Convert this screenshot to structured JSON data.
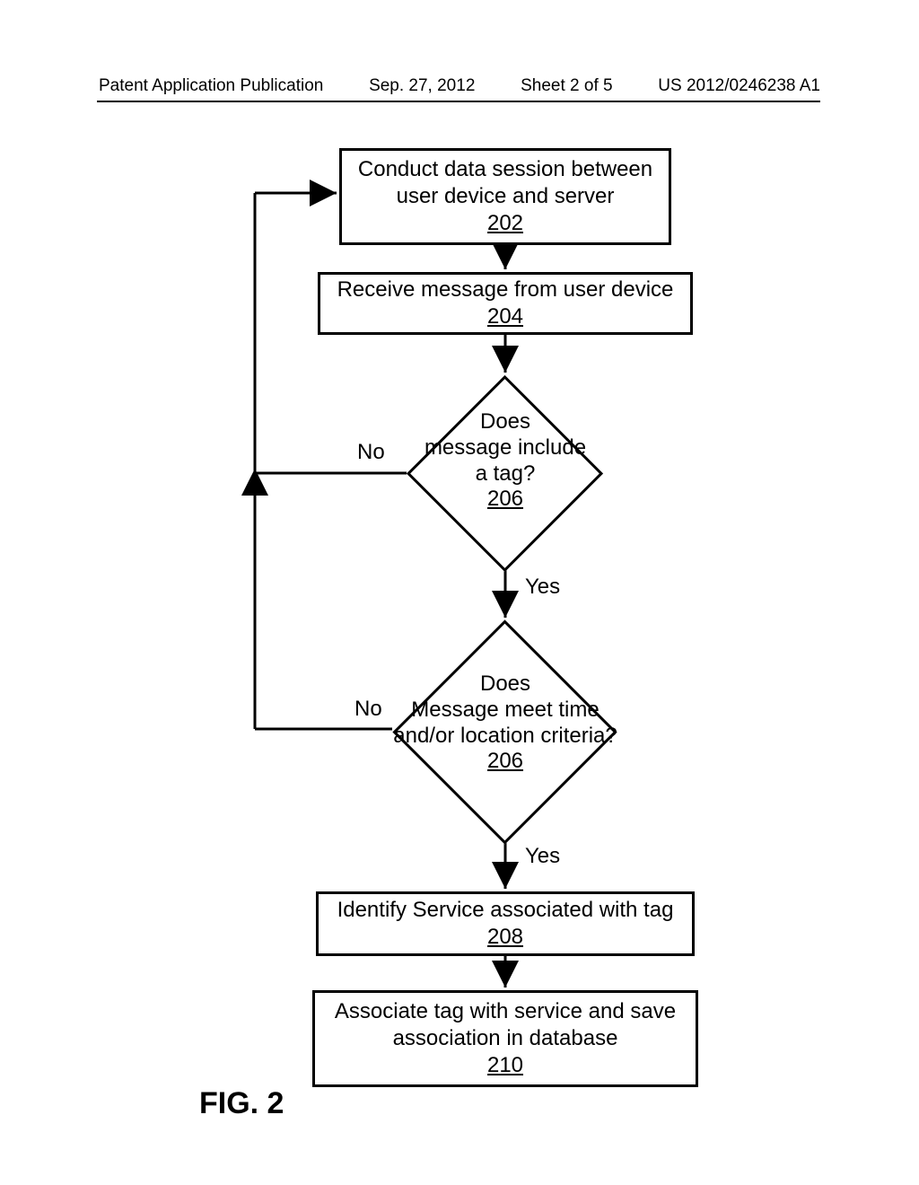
{
  "header": {
    "publication_label": "Patent Application Publication",
    "date": "Sep. 27, 2012",
    "sheet": "Sheet 2 of 5",
    "pub_number": "US 2012/0246238 A1"
  },
  "chart_data": {
    "type": "flowchart",
    "title": "FIG. 2",
    "nodes": [
      {
        "id": "202",
        "type": "process",
        "text": "Conduct data session between user device and server",
        "ref": "202"
      },
      {
        "id": "204",
        "type": "process",
        "text": "Receive message from user device",
        "ref": "204"
      },
      {
        "id": "206a",
        "type": "decision",
        "text": "Does message include a tag?",
        "ref": "206"
      },
      {
        "id": "206b",
        "type": "decision",
        "text": "Does Message meet time and/or location criteria?",
        "ref": "206"
      },
      {
        "id": "208",
        "type": "process",
        "text": "Identify Service associated with tag",
        "ref": "208"
      },
      {
        "id": "210",
        "type": "process",
        "text": "Associate tag with service and save association in database",
        "ref": "210"
      }
    ],
    "edges": [
      {
        "from": "202",
        "to": "204",
        "label": ""
      },
      {
        "from": "204",
        "to": "206a",
        "label": ""
      },
      {
        "from": "206a",
        "to": "206b",
        "label": "Yes"
      },
      {
        "from": "206b",
        "to": "208",
        "label": "Yes"
      },
      {
        "from": "208",
        "to": "210",
        "label": ""
      },
      {
        "from": "206a",
        "to": "202",
        "label": "No"
      },
      {
        "from": "206b",
        "to": "202",
        "label": "No"
      }
    ],
    "labels": {
      "yes": "Yes",
      "no": "No"
    }
  },
  "boxes": {
    "b202": {
      "text": "Conduct data session between user device and server",
      "ref": "202"
    },
    "b204": {
      "text": "Receive message from user device",
      "ref": "204"
    },
    "d206a_l1": "Does",
    "d206a_l2": "message include",
    "d206a_l3": "a tag?",
    "d206a_ref": "206",
    "d206b_l1": "Does",
    "d206b_l2": "Message meet time",
    "d206b_l3": "and/or location criteria?",
    "d206b_ref": "206",
    "b208": {
      "text": "Identify Service associated with tag",
      "ref": "208"
    },
    "b210": {
      "text": "Associate tag with service and save association in database",
      "ref": "210"
    }
  },
  "figure_label": "FIG. 2"
}
